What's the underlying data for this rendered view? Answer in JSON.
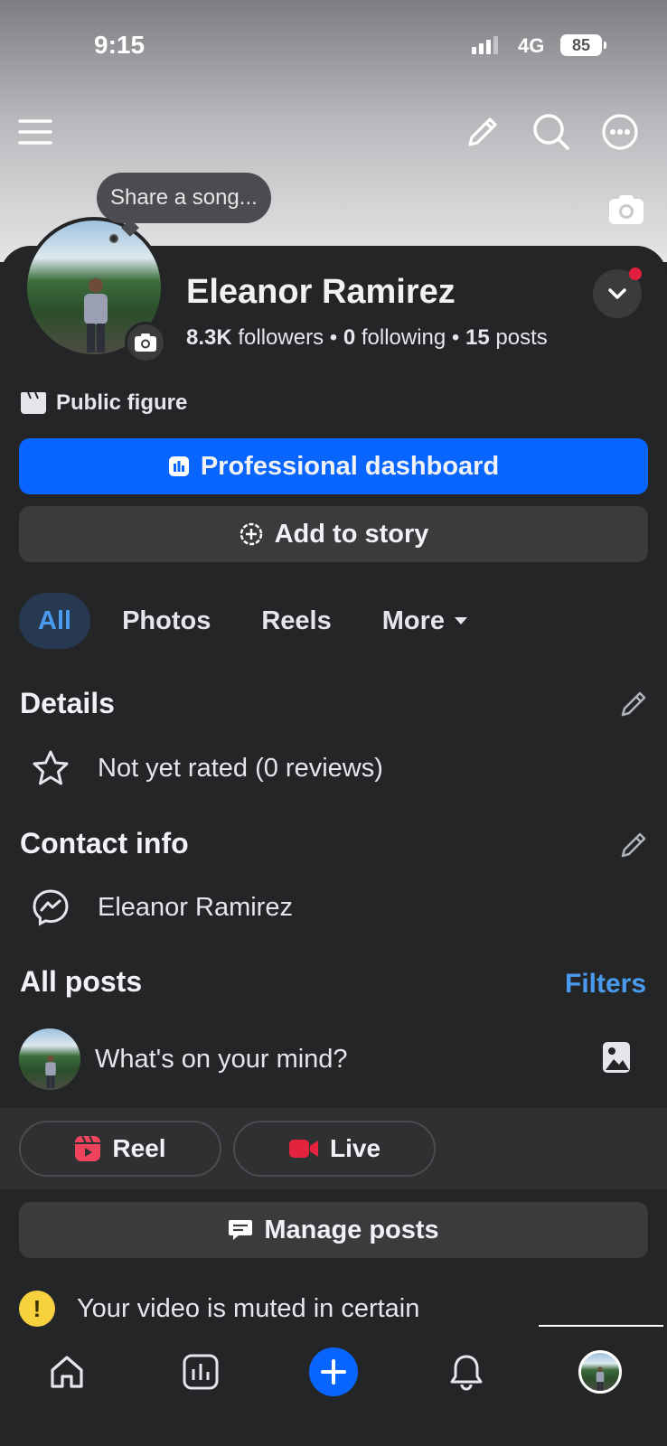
{
  "status_bar": {
    "time": "9:15",
    "network": "4G",
    "battery": "85"
  },
  "header": {
    "share_song_prompt": "Share a song..."
  },
  "profile": {
    "name": "Eleanor Ramirez",
    "followers_count": "8.3K",
    "followers_label": "followers",
    "following_count": "0",
    "following_label": "following",
    "posts_count": "15",
    "posts_label": "posts",
    "category": "Public figure"
  },
  "actions": {
    "dashboard_label": "Professional dashboard",
    "add_story_label": "Add to story"
  },
  "tabs": [
    {
      "label": "All",
      "active": true
    },
    {
      "label": "Photos",
      "active": false
    },
    {
      "label": "Reels",
      "active": false
    },
    {
      "label": "More",
      "active": false
    }
  ],
  "details": {
    "title": "Details",
    "rating_text": "Not yet rated (0 reviews)"
  },
  "contact": {
    "title": "Contact info",
    "messenger_name": "Eleanor Ramirez"
  },
  "posts": {
    "title": "All posts",
    "filters_label": "Filters",
    "composer_placeholder": "What's on your mind?",
    "reel_label": "Reel",
    "live_label": "Live",
    "manage_label": "Manage posts",
    "muted_notice": "Your video is muted in certain"
  },
  "colors": {
    "accent_blue": "#0866ff",
    "link_blue": "#4a9bf0",
    "background": "#242527",
    "notification_red": "#e41e3f",
    "warning_yellow": "#f7d13e"
  },
  "nav": {
    "items": [
      "home-icon",
      "dashboard-icon",
      "create-icon",
      "bell-icon",
      "profile-avatar"
    ]
  }
}
